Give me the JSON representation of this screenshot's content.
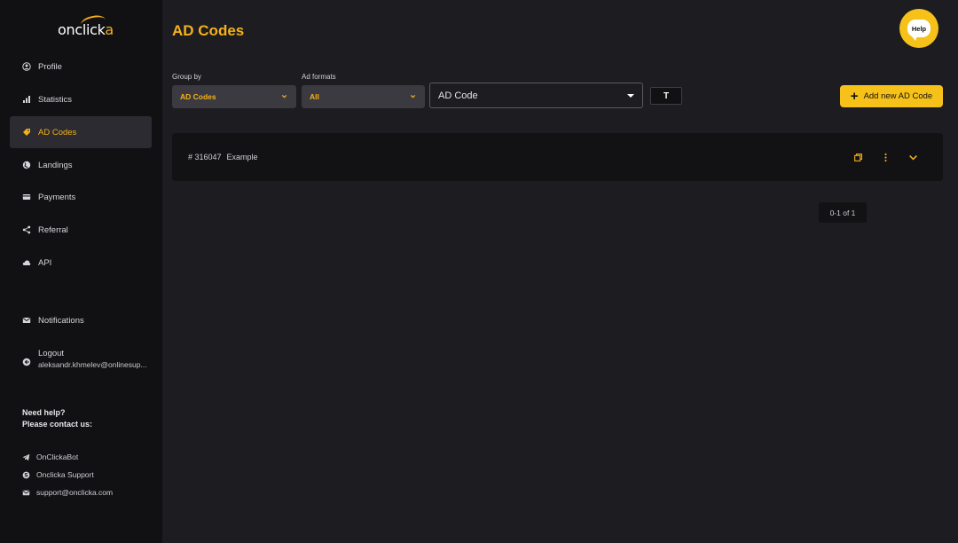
{
  "brand": {
    "logo_main": "onclick",
    "logo_accent": "a"
  },
  "sidebar": {
    "items": [
      {
        "label": "Profile",
        "icon": "user-circle-icon"
      },
      {
        "label": "Statistics",
        "icon": "bar-chart-icon"
      },
      {
        "label": "AD Codes",
        "icon": "tag-icon",
        "active": true
      },
      {
        "label": "Landings",
        "icon": "globe-icon"
      },
      {
        "label": "Payments",
        "icon": "card-icon"
      },
      {
        "label": "Referral",
        "icon": "share-icon"
      },
      {
        "label": "API",
        "icon": "cloud-icon"
      },
      {
        "label": "Notifications",
        "icon": "mail-icon"
      }
    ],
    "logout": {
      "label": "Logout",
      "email": "aleksandr.khmelev@onlinesup..."
    },
    "help": {
      "line1": "Need help?",
      "line2": "Please contact us:"
    },
    "contacts": [
      {
        "label": "OnClickaBot",
        "icon": "telegram-icon"
      },
      {
        "label": "Onclicka Support",
        "icon": "skype-icon"
      },
      {
        "label": "support@onclicka.com",
        "icon": "mail-icon"
      }
    ]
  },
  "header": {
    "title": "AD Codes",
    "help_label": "Help"
  },
  "filters": {
    "group_by": {
      "label": "Group by",
      "value": "AD Codes"
    },
    "ad_formats": {
      "label": "Ad formats",
      "value": "All"
    },
    "ad_code": {
      "value": "AD Code"
    },
    "text_toggle": "T",
    "add_button": "Add new AD Code"
  },
  "codes": [
    {
      "id": "# 316047",
      "name": "Example"
    }
  ],
  "pagination": {
    "text": "0-1 of 1"
  },
  "colors": {
    "accent": "#f6b11a",
    "background": "#1c1c21",
    "sidebar": "#111114"
  }
}
